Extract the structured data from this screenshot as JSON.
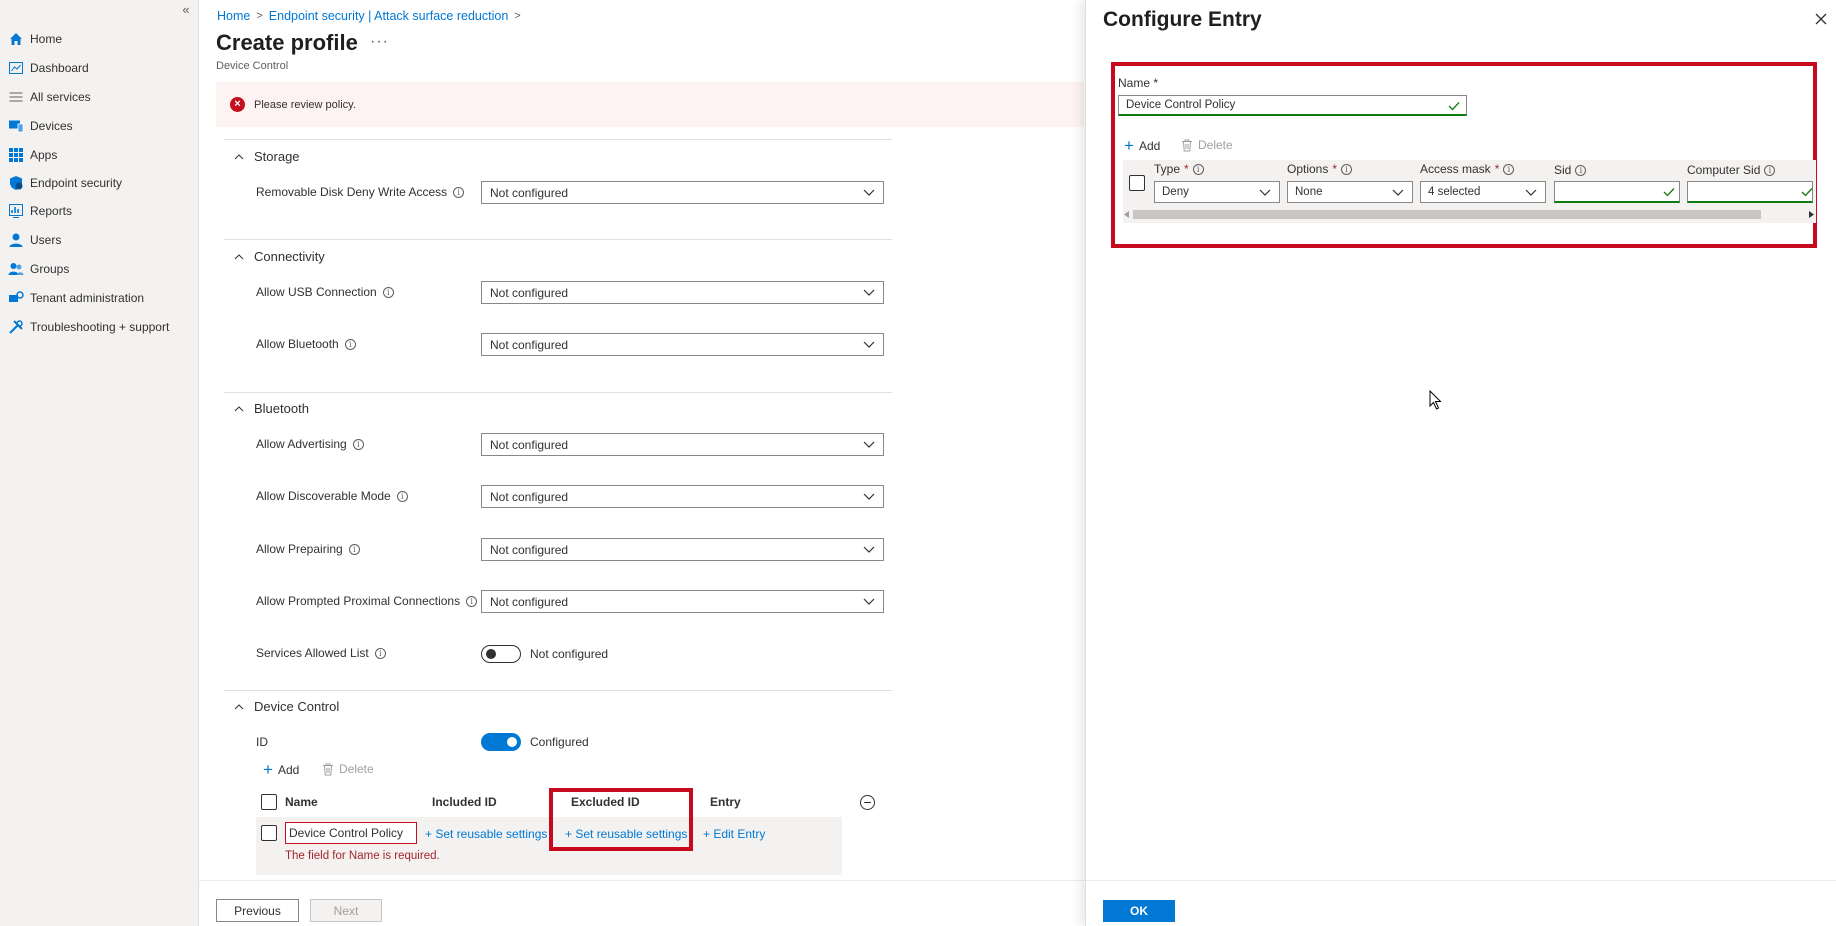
{
  "sidebar": {
    "collapse_glyph": "«",
    "items": [
      {
        "label": "Home",
        "icon": "home-icon"
      },
      {
        "label": "Dashboard",
        "icon": "dashboard-icon"
      },
      {
        "label": "All services",
        "icon": "list-icon"
      },
      {
        "label": "Devices",
        "icon": "devices-icon"
      },
      {
        "label": "Apps",
        "icon": "apps-grid-icon"
      },
      {
        "label": "Endpoint security",
        "icon": "shield-icon"
      },
      {
        "label": "Reports",
        "icon": "reports-icon"
      },
      {
        "label": "Users",
        "icon": "user-icon"
      },
      {
        "label": "Groups",
        "icon": "groups-icon"
      },
      {
        "label": "Tenant administration",
        "icon": "tenant-admin-icon"
      },
      {
        "label": "Troubleshooting + support",
        "icon": "troubleshoot-icon"
      }
    ]
  },
  "breadcrumb": [
    "Home",
    "Endpoint security | Attack surface reduction"
  ],
  "page": {
    "title": "Create profile",
    "more": "···",
    "subtitle": "Device Control",
    "error_banner": "Please review policy."
  },
  "sections": {
    "storage": {
      "title": "Storage",
      "settings": [
        {
          "label": "Removable Disk Deny Write Access",
          "value": "Not configured"
        }
      ]
    },
    "connectivity": {
      "title": "Connectivity",
      "settings": [
        {
          "label": "Allow USB Connection",
          "value": "Not configured"
        },
        {
          "label": "Allow Bluetooth",
          "value": "Not configured"
        }
      ]
    },
    "bluetooth": {
      "title": "Bluetooth",
      "settings": [
        {
          "label": "Allow Advertising",
          "value": "Not configured"
        },
        {
          "label": "Allow Discoverable Mode",
          "value": "Not configured"
        },
        {
          "label": "Allow Prepairing",
          "value": "Not configured"
        },
        {
          "label": "Allow Prompted Proximal Connections",
          "value": "Not configured"
        }
      ],
      "services_allowed_list": {
        "label": "Services Allowed List",
        "state": "Not configured"
      }
    },
    "device_control": {
      "title": "Device Control",
      "id_label": "ID",
      "id_state": "Configured",
      "add_label": "Add",
      "delete_label": "Delete",
      "columns": [
        "Name",
        "Included ID",
        "Excluded ID",
        "Entry"
      ],
      "row": {
        "name": "Device Control Policy",
        "included": "+ Set reusable settings",
        "excluded": "+ Set reusable settings",
        "entry": "+ Edit Entry",
        "error": "The field for Name is required."
      }
    }
  },
  "footer": {
    "previous": "Previous",
    "next": "Next"
  },
  "panel": {
    "title": "Configure Entry",
    "name_label": "Name",
    "name_required": "*",
    "name_value": "Device Control Policy",
    "add_label": "Add",
    "delete_label": "Delete",
    "columns": [
      {
        "label": "Type",
        "required": true
      },
      {
        "label": "Options",
        "required": true
      },
      {
        "label": "Access mask",
        "required": true
      },
      {
        "label": "Sid",
        "required": false
      },
      {
        "label": "Computer Sid",
        "required": false
      }
    ],
    "row": {
      "type": "Deny",
      "options": "None",
      "access_mask": "4 selected",
      "sid": "",
      "computer_sid": ""
    },
    "ok": "OK"
  },
  "colors": {
    "accent": "#0078d4",
    "error": "#c50f1f",
    "highlight_box": "#c80a1e",
    "success": "#107c10"
  }
}
